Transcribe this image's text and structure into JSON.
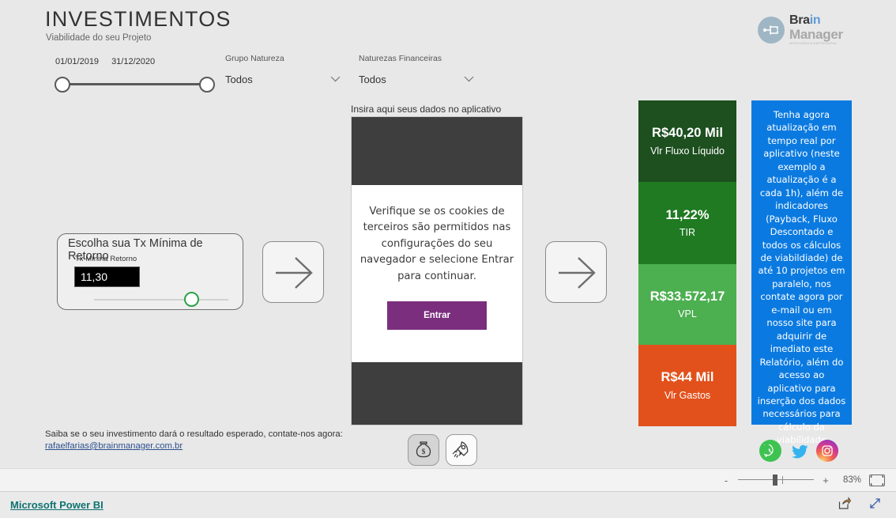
{
  "header": {
    "title": "INVESTIMENTOS",
    "subtitle": "Viabilidade do seu Projeto"
  },
  "logo": {
    "line1_dark": "Bra",
    "line1_blue": "in",
    "line2": "Manager",
    "line3": "INTELIGÊNCIA EMPRESARIAL",
    "brand_blue": "#5b9bd5",
    "brand_gray": "#a8a8a8"
  },
  "date_slicer": {
    "start": "01/01/2019",
    "end": "31/12/2020"
  },
  "slicers": [
    {
      "label": "Grupo Natureza",
      "value": "Todos"
    },
    {
      "label": "Naturezas Financeiras",
      "value": "Todos"
    }
  ],
  "tx_card": {
    "title": "Escolha sua Tx Mínima de Retorno",
    "field_label": "Tx Mínina Retorno",
    "value": "11,30",
    "accent": "#2aa148"
  },
  "app": {
    "label": "Insira aqui seus dados no aplicativo",
    "message": "Verifique se os cookies de terceiros são permitidos nas configurações do seu navegador e selecione Entrar para continuar.",
    "button": "Entrar",
    "button_color": "#7b2e7e"
  },
  "kpis": [
    {
      "value": "R$40,20 Mil",
      "label": "Vlr Fluxo Líquido",
      "color": "#1d4f1f"
    },
    {
      "value": "11,22%",
      "label": "TIR",
      "color": "#1f7a22"
    },
    {
      "value": "R$33.572,17",
      "label": "VPL",
      "color": "#4caf50"
    },
    {
      "value": "R$44 Mil",
      "label": "Vlr Gastos",
      "color": "#e2511c"
    }
  ],
  "promo": {
    "text": "Tenha agora atualização em tempo real por aplicativo (neste exemplo a atualização é a cada 1h), além de indicadores (Payback, Fluxo Descontado e todos os cálculos de viabildiade) de até 10 projetos em paralelo, nos contate agora por e-mail ou em nosso site para adquirir de imediato este Relatório, além do acesso ao aplicativo para inserção dos dados necessários para cálculo da viabilidade",
    "color": "#0b7ae0"
  },
  "contact": {
    "text": "Saiba se o seu investimento dará o resultado esperado, contate-nos agora:",
    "email": "rafaelfarias@brainmanager.com.br"
  },
  "toggles": [
    {
      "name": "money-bag",
      "selected": true
    },
    {
      "name": "rocket",
      "selected": false
    }
  ],
  "social": [
    {
      "name": "whatsapp"
    },
    {
      "name": "twitter"
    },
    {
      "name": "instagram"
    }
  ],
  "statusbar": {
    "zoom_minus": "-",
    "zoom_plus": "+",
    "zoom_level": "83%"
  },
  "bottombar": {
    "powerbi_link": "Microsoft Power BI",
    "link_color": "#117272"
  }
}
